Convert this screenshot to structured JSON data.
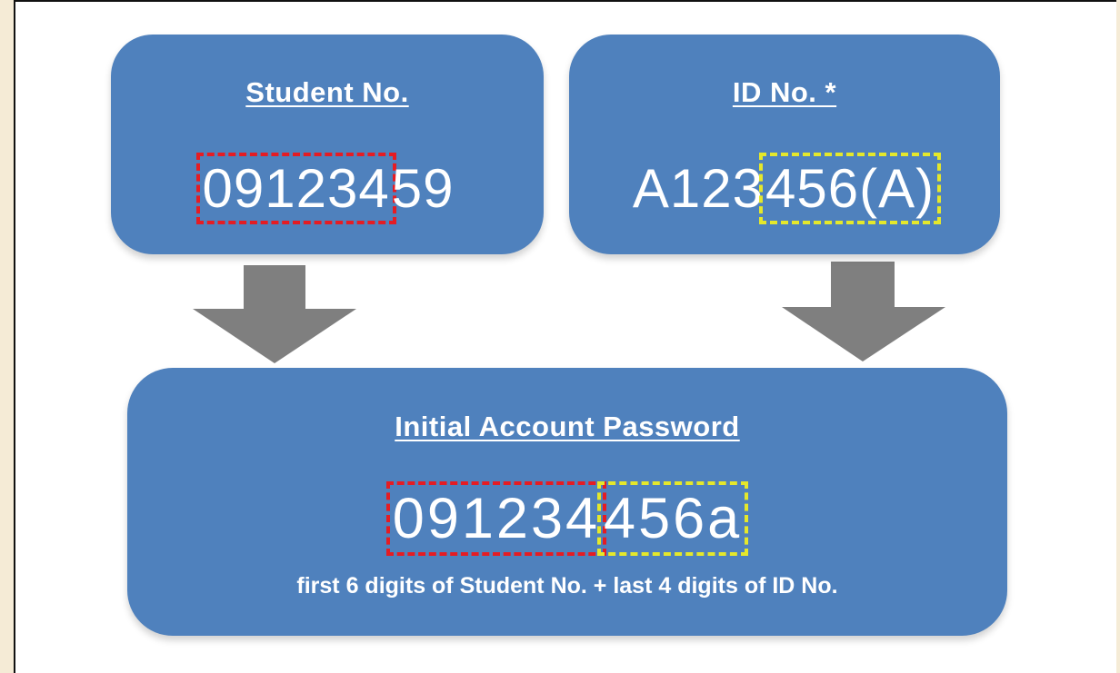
{
  "student_box": {
    "heading": "Student No.",
    "value_highlighted": "091234",
    "value_rest": "59"
  },
  "id_box": {
    "heading": "ID No. *",
    "value_plain": "A123",
    "value_highlighted": "456(A)"
  },
  "password_box": {
    "heading": "Initial Account Password",
    "value_from_student": "091234",
    "value_from_id": "456a",
    "caption": "first 6 digits of Student No. + last 4 digits of ID No."
  },
  "colors": {
    "box_fill": "#4f81bd",
    "arrow_fill": "#7f7f7f",
    "student_highlight": "#e51c23",
    "id_highlight": "#e5e82b",
    "background": "#ffffff",
    "page_margin": "#f5ebd6"
  }
}
